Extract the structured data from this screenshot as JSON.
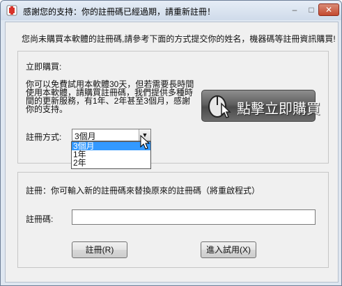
{
  "window": {
    "title": "感謝您的支持：你的註冊碼已經過期，請重新註冊！",
    "min_icon": "minimize-icon",
    "max_icon": "maximize-icon",
    "close_icon": "close-icon",
    "min_glyph": "–",
    "max_glyph": "□",
    "close_glyph": "✕"
  },
  "intro": "您尚未購買本軟體的註冊碼,請參考下面的方式提交你的姓名，機器碼等註冊資訊購買!",
  "buy_section": {
    "heading": "立即購買:",
    "description": "你可以免費試用本軟體30天，但若需要長時間使用本軟體，請購買註冊碼，我們提供多種時間的更新服務，有1年、2年甚至3個月，感謝你的支持。",
    "buy_button": "點擊立即購買",
    "method_label": "註冊方式:",
    "method_selected": "3個月",
    "method_options": [
      "3個月",
      "1年",
      "2年"
    ]
  },
  "register_section": {
    "heading": "註冊：你可輸入新的註冊碼來替換原來的註冊碼（將重啟程式）",
    "code_label": "註冊碼:",
    "code_value": "",
    "register_button": "註冊(R)",
    "trial_button": "進入試用(X)"
  }
}
